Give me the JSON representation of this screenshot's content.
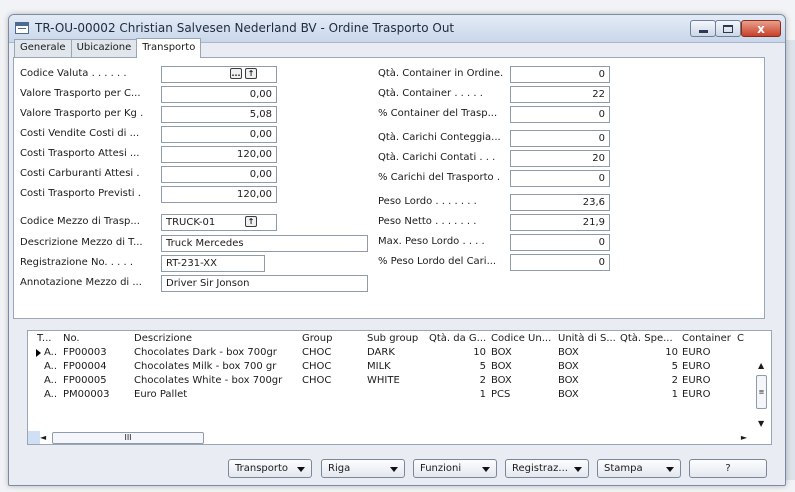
{
  "window": {
    "title": "TR-OU-00002 Christian Salvesen Nederland BV - Ordine Trasporto Out",
    "controls": {
      "minimize": "",
      "maximize": "",
      "close": "x"
    }
  },
  "tabs": [
    {
      "label": "Generale",
      "active": false
    },
    {
      "label": "Ubicazione",
      "active": false
    },
    {
      "label": "Transporto",
      "active": true
    }
  ],
  "left_fields": [
    {
      "label": "Codice Valuta . . . . . .",
      "value": ""
    },
    {
      "label": "Valore Trasporto per C...",
      "value": "0,00"
    },
    {
      "label": "Valore Trasporto per Kg .",
      "value": "5,08"
    },
    {
      "label": "Costi Vendite Costi di ...",
      "value": "0,00"
    },
    {
      "label": "Costi Trasporto Attesi ...",
      "value": "120,00"
    },
    {
      "label": "Costi Carburanti Attesi  .",
      "value": "0,00"
    },
    {
      "label": "Costi Trasporto Previsti  .",
      "value": "120,00"
    },
    {
      "label": "Codice Mezzo di Trasp...",
      "value": "TRUCK-01"
    },
    {
      "label": "Descrizione Mezzo di T...",
      "value": "Truck Mercedes"
    },
    {
      "label": "Registrazione No. . . . .",
      "value": "RT-231-XX"
    },
    {
      "label": "Annotazione Mezzo di ...",
      "value": "Driver Sir Jonson"
    }
  ],
  "right_fields": [
    {
      "label": "Qtà. Container in Ordine.",
      "value": "0"
    },
    {
      "label": "Qtà. Container  . . . . .",
      "value": "22"
    },
    {
      "label": "% Container del Trasp...",
      "value": "0"
    },
    {
      "label": "Qtà. Carichi Conteggia...",
      "value": "0"
    },
    {
      "label": "Qtà. Carichi Contati . . .",
      "value": "20"
    },
    {
      "label": "% Carichi del Trasporto  .",
      "value": "0"
    },
    {
      "label": "Peso Lordo . . . . . . .",
      "value": "23,6"
    },
    {
      "label": "Peso Netto  . . . . . . .",
      "value": "21,9"
    },
    {
      "label": "Max. Peso Lordo  . . . .",
      "value": "0"
    },
    {
      "label": "% Peso Lordo del Cari...",
      "value": "0"
    }
  ],
  "lookup_glyphs": {
    "ellipsis": "...",
    "arrow": "↑"
  },
  "grid": {
    "columns": [
      "T...",
      "No.",
      "Descrizione",
      "Group",
      "Sub group",
      "Qtà. da G...",
      "Codice Un...",
      "Unità di S...",
      "Qtà. Spe...",
      "Container",
      "C"
    ],
    "rows": [
      {
        "type": "A..",
        "no": "FP00003",
        "desc": "Chocolates Dark - box 700gr",
        "group": "CHOC",
        "subgroup": "DARK",
        "qty": "10",
        "uom": "BOX",
        "unit": "BOX",
        "qtysp": "10",
        "container": "EURO"
      },
      {
        "type": "A..",
        "no": "FP00004",
        "desc": "Chocolates Milk - box 700 gr",
        "group": "CHOC",
        "subgroup": "MILK",
        "qty": "5",
        "uom": "BOX",
        "unit": "BOX",
        "qtysp": "5",
        "container": "EURO"
      },
      {
        "type": "A..",
        "no": "FP00005",
        "desc": "Chocolates White - box 700gr",
        "group": "CHOC",
        "subgroup": "WHITE",
        "qty": "2",
        "uom": "BOX",
        "unit": "BOX",
        "qtysp": "2",
        "container": "EURO"
      },
      {
        "type": "A..",
        "no": "PM00003",
        "desc": "Euro Pallet",
        "group": "",
        "subgroup": "",
        "qty": "1",
        "uom": "PCS",
        "unit": "BOX",
        "qtysp": "1",
        "container": "EURO"
      }
    ],
    "scroll": {
      "up": "▲",
      "down": "▼",
      "left": "◄",
      "right": "►",
      "hthumb": "III",
      "vthumb": "≡"
    }
  },
  "buttons": [
    {
      "label": "Transporto",
      "dropdown": true
    },
    {
      "label": "Riga",
      "dropdown": true
    },
    {
      "label": "Funzioni",
      "dropdown": true
    },
    {
      "label": "Registraz...",
      "dropdown": true
    },
    {
      "label": "Stampa",
      "dropdown": true
    },
    {
      "label": "?",
      "dropdown": false
    }
  ]
}
